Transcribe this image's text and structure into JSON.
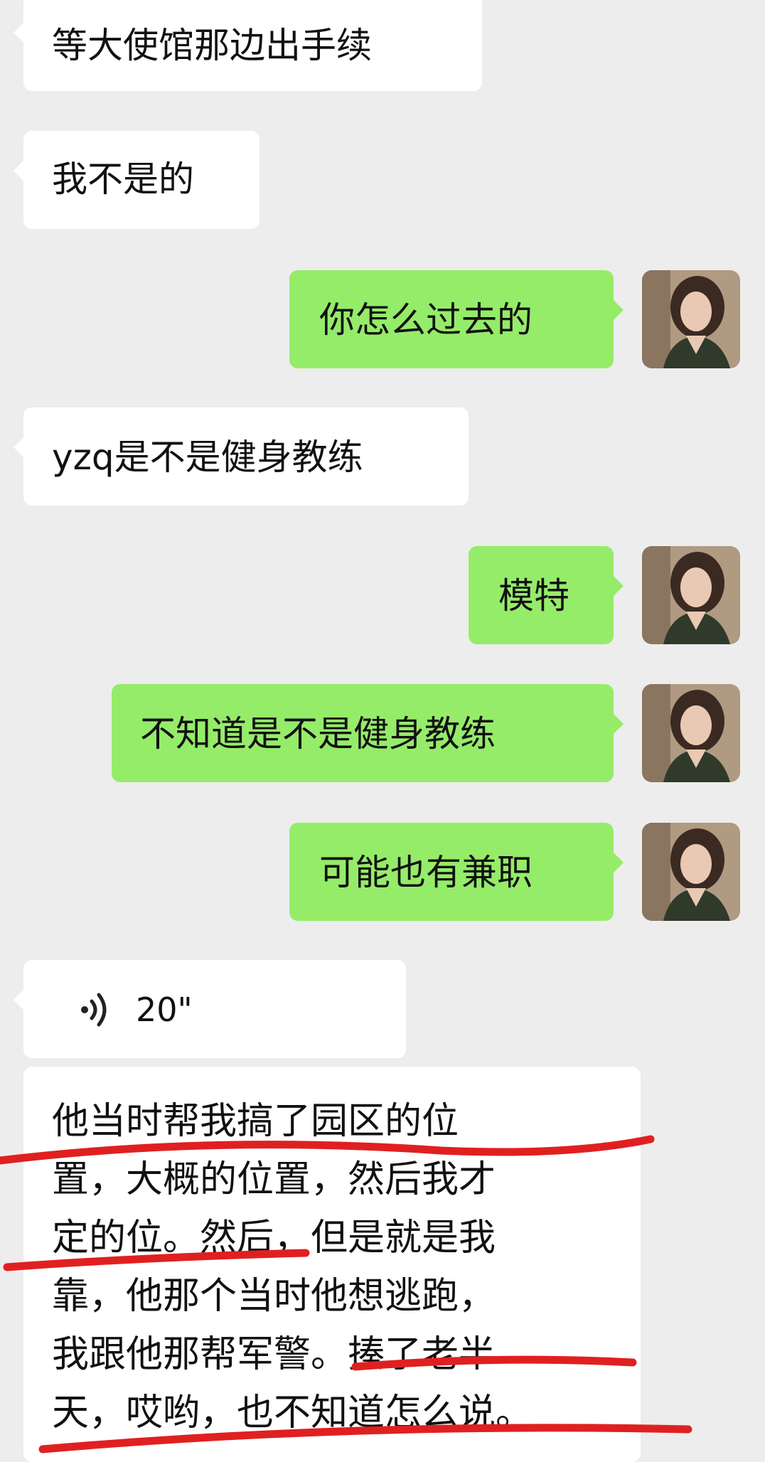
{
  "messages": [
    {
      "side": "left",
      "text": "等大使馆那边出手续"
    },
    {
      "side": "left",
      "text": "我不是的"
    },
    {
      "side": "right",
      "text": "你怎么过去的"
    },
    {
      "side": "left",
      "text": "yzq是不是健身教练"
    },
    {
      "side": "right",
      "text": "模特"
    },
    {
      "side": "right",
      "text": "不知道是不是健身教练"
    },
    {
      "side": "right",
      "text": "可能也有兼职"
    }
  ],
  "voice": {
    "duration": "20\""
  },
  "transcript": {
    "lines": [
      "他当时帮我搞了园区的位",
      "置，大概的位置，然后我才",
      "定的位。然后，但是就是我",
      "靠，他那个当时他想逃跑，",
      "我跟他那帮军警。揍了老半",
      "天，哎哟，也不知道怎么说。"
    ]
  },
  "colors": {
    "background": "#ededed",
    "sent_bubble": "#95ec69",
    "received_bubble": "#ffffff",
    "annotation": "#e02020"
  },
  "icons": [
    "voice-wave-icon",
    "avatar"
  ]
}
